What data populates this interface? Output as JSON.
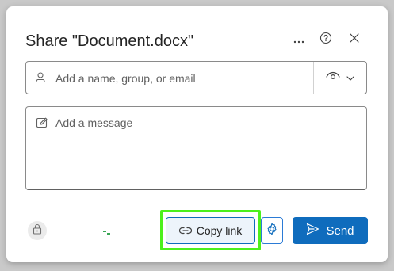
{
  "dialog": {
    "title": "Share \"Document.docx\"",
    "header_buttons": [
      "more-options",
      "help",
      "close"
    ]
  },
  "recipients": {
    "placeholder": "Add a name, group, or email",
    "value": "",
    "permission_icon": "eye-icon"
  },
  "message": {
    "placeholder": "Add a message",
    "value": ""
  },
  "footer": {
    "copy_link_label": "Copy link",
    "send_label": "Send"
  },
  "colors": {
    "primary": "#0f6cbd",
    "highlight": "#4cf01c",
    "copy_bg": "#edf4fb"
  }
}
